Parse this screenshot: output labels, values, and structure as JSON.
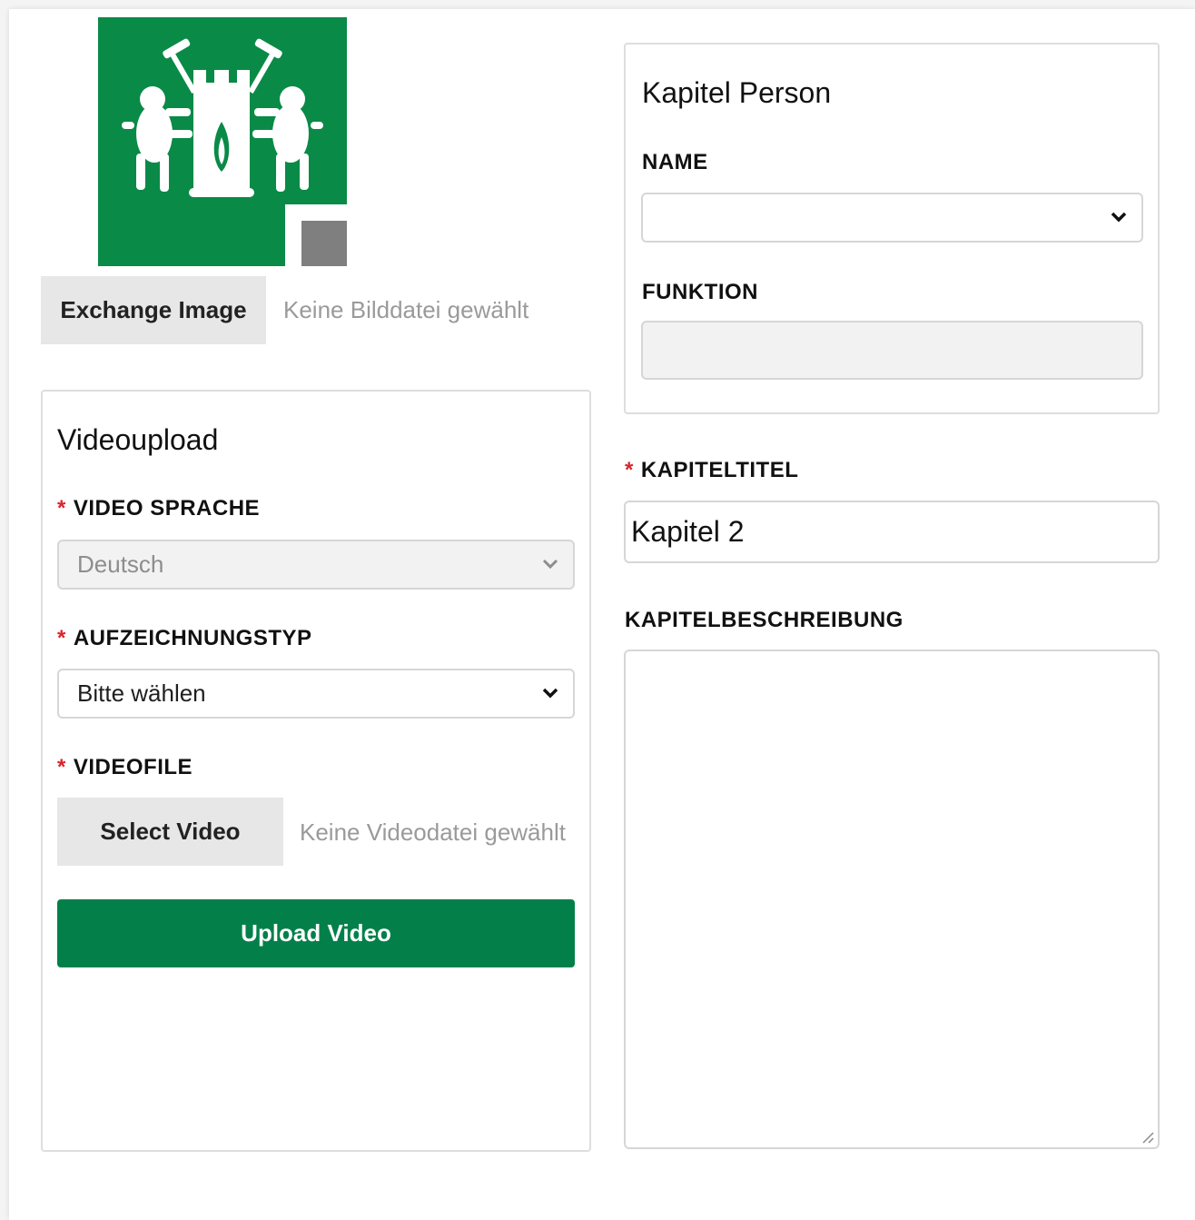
{
  "logo": {
    "bg_color": "#0a8a47",
    "accent_gray": "#7f7f7f",
    "icon": "coat-of-arms-icon"
  },
  "image": {
    "exchange_label": "Exchange Image",
    "file_hint": "Keine Bilddatei gewählt"
  },
  "video_upload": {
    "title": "Videoupload",
    "language_label": "VIDEO SPRACHE",
    "language_value": "Deutsch",
    "type_label": "AUFZEICHNUNGSTYP",
    "type_value": "Bitte wählen",
    "file_label": "VIDEOFILE",
    "select_label": "Select Video",
    "file_hint": "Keine Videodatei gewählt",
    "upload_label": "Upload Video",
    "required_mark": "*"
  },
  "person": {
    "title": "Kapitel Person",
    "name_label": "NAME",
    "name_value": "",
    "function_label": "FUNKTION",
    "function_value": ""
  },
  "chapter": {
    "title_label": "KAPITELTITEL",
    "title_value": "Kapitel 2",
    "description_label": "KAPITELBESCHREIBUNG",
    "description_value": "",
    "required_mark": "*"
  },
  "colors": {
    "primary": "#03804a",
    "required": "#d9232d"
  }
}
